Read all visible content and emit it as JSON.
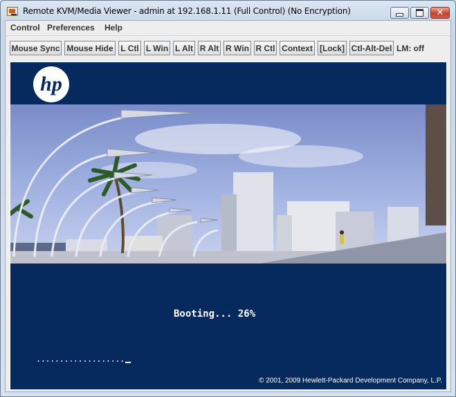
{
  "window": {
    "title": "Remote KVM/Media Viewer - admin at 192.168.1.11 (Full Control) (No Encryption)",
    "icon": "kvm-app-icon",
    "controls": {
      "minimize": "minimize-icon",
      "maximize": "maximize-icon",
      "close": "close-icon"
    }
  },
  "menubar": {
    "items": [
      "Control",
      "Preferences",
      "Help"
    ]
  },
  "toolbar": {
    "buttons": [
      "Mouse Sync",
      "Mouse Hide",
      "L Ctl",
      "L Win",
      "L Alt",
      "R Alt",
      "R Win",
      "R Ctl",
      "Context",
      "[Lock]",
      "Ctl-Alt-Del"
    ],
    "lm_status": "LM: off"
  },
  "screen": {
    "logo_text": "hp",
    "boot_message": "Booting... 26%",
    "boot_progress_percent": 26,
    "progress_dots": "...................",
    "copyright": "© 2001, 2009 Hewlett-Packard Development Company, L.P."
  },
  "colors": {
    "screen_background": "#06295e",
    "text": "#ffffff",
    "close_button": "#c64430"
  }
}
